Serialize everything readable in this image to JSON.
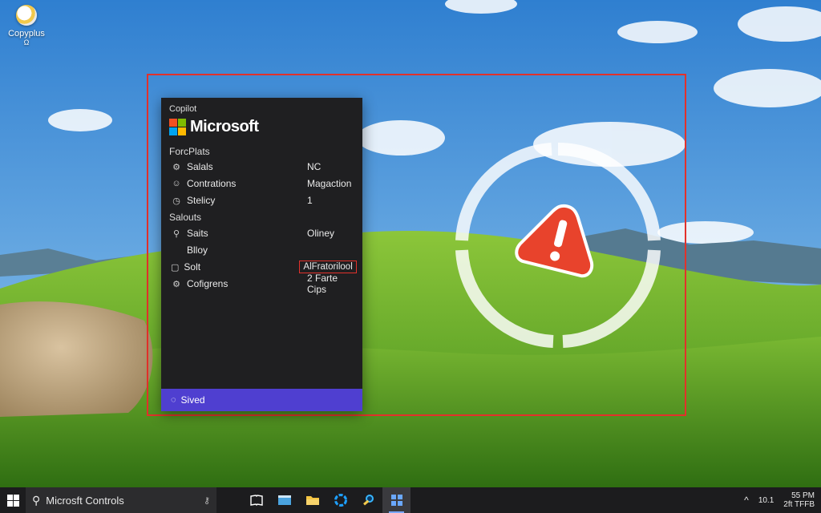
{
  "desktop": {
    "icon_label": "Copyplus",
    "icon_sublabel": "Ω"
  },
  "panel": {
    "app_title": "Copilot",
    "brand": "Microsoft",
    "section1_title": "ForcPlats",
    "rows1": [
      {
        "icon": "⚙",
        "label": "Salals",
        "value": "NC"
      },
      {
        "icon": "☺",
        "label": "Contrations",
        "value": "Magaction"
      },
      {
        "icon": "◷",
        "label": "Stelicy",
        "value": "1"
      }
    ],
    "section2_title": "Salouts",
    "rows2": [
      {
        "icon": "⚲",
        "label": "Saits",
        "value": "Oliney"
      },
      {
        "icon": "",
        "label": "Blloy",
        "value": ""
      },
      {
        "icon": "▢",
        "label": "Solt",
        "value": "AlFratorilool"
      },
      {
        "icon": "⚙",
        "label": "Cofigrens",
        "value": "2 Farte Cips"
      }
    ],
    "footer_label": "Sived"
  },
  "taskbar": {
    "search_text": "Microsft Controls",
    "tray_num": "10.1",
    "time": "55 PM",
    "date": "2ft TFFB"
  },
  "colors": {
    "accent": "#4f3fd0",
    "alert": "#e8432c",
    "frame": "#e2312b",
    "ms_red": "#f25022",
    "ms_green": "#7fba00",
    "ms_blue": "#00a4ef",
    "ms_yellow": "#ffb900"
  }
}
